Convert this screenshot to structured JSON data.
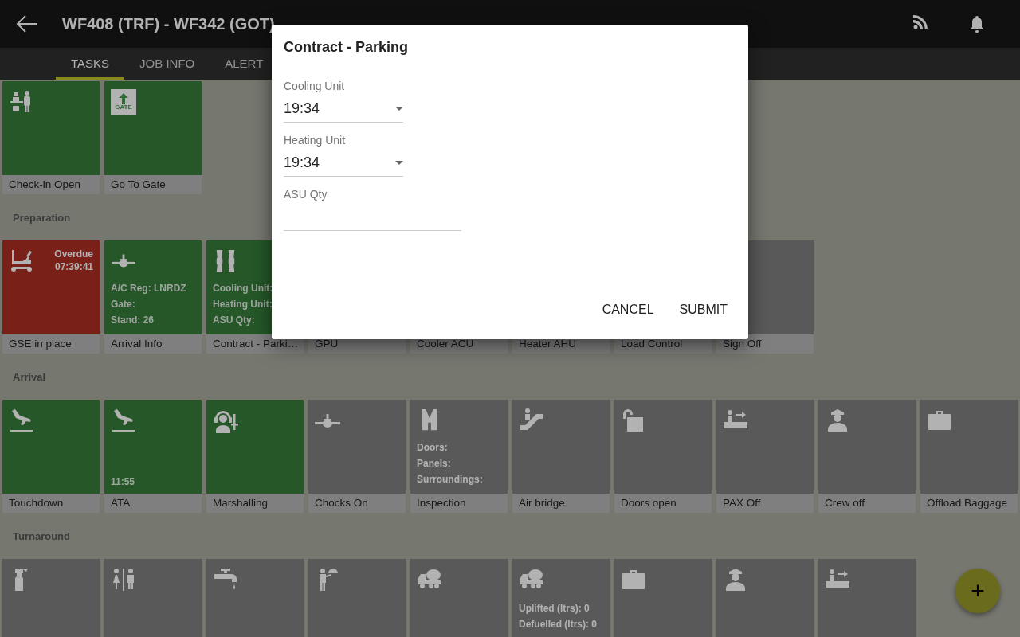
{
  "header": {
    "title": "WF408 (TRF) - WF342 (GOT)"
  },
  "tabs": [
    {
      "label": "TASKS",
      "selected": true
    },
    {
      "label": "JOB INFO",
      "selected": false
    },
    {
      "label": "ALERT",
      "selected": false
    }
  ],
  "sections": [
    {
      "tiles": [
        {
          "label": "Check-in Open",
          "kind": "done"
        },
        {
          "label": "Go To Gate",
          "kind": "done",
          "sign": "GATE"
        }
      ]
    },
    {
      "title": "Preparation",
      "tiles": [
        {
          "label": "GSE in place",
          "kind": "overdue",
          "alert": [
            "Overdue",
            "07:39:41"
          ]
        },
        {
          "label": "Arrival Info",
          "kind": "done",
          "details": [
            "A/C Reg: LNRDZ",
            "Gate:",
            "Stand: 26"
          ]
        },
        {
          "label": "Contract - Parki…",
          "kind": "done",
          "details": [
            "Cooling Unit:",
            "Heating Unit:",
            "ASU Qty:"
          ]
        },
        {
          "label": "GPU"
        },
        {
          "label": "Cooler ACU"
        },
        {
          "label": "Heater AHU"
        },
        {
          "label": "Load Control"
        },
        {
          "label": "Sign Off",
          "kind": "pending"
        }
      ]
    },
    {
      "title": "Arrival",
      "tiles": [
        {
          "label": "Touchdown",
          "kind": "done"
        },
        {
          "label": "ATA",
          "kind": "done",
          "time": "11:55"
        },
        {
          "label": "Marshalling",
          "kind": "done"
        },
        {
          "label": "Chocks On",
          "kind": "pending"
        },
        {
          "label": "Inspection",
          "kind": "pending",
          "details": [
            "Doors:",
            "Panels:",
            "Surroundings:"
          ]
        },
        {
          "label": "Air bridge",
          "kind": "pending"
        },
        {
          "label": "Doors open",
          "kind": "pending"
        },
        {
          "label": "PAX Off",
          "kind": "pending"
        },
        {
          "label": "Crew off",
          "kind": "pending"
        },
        {
          "label": "Offload Baggage",
          "kind": "pending"
        }
      ]
    },
    {
      "title": "Turnaround",
      "tiles": [
        {
          "kind": "pending"
        },
        {
          "kind": "pending"
        },
        {
          "kind": "pending"
        },
        {
          "kind": "pending"
        },
        {
          "kind": "pending"
        },
        {
          "kind": "pending",
          "details": [
            "Uplifted (ltrs): 0",
            "Defuelled (ltrs): 0"
          ]
        },
        {
          "kind": "pending"
        },
        {
          "kind": "pending"
        },
        {
          "kind": "pending"
        }
      ]
    }
  ],
  "fab": {
    "label": "+"
  },
  "dialog": {
    "modal": true,
    "title": "Contract - Parking",
    "fields": [
      {
        "label": "Cooling Unit",
        "kind": "select",
        "value": "19:34"
      },
      {
        "label": "Heating Unit",
        "kind": "select",
        "value": "19:34"
      },
      {
        "label": "ASU Qty",
        "kind": "input"
      }
    ],
    "buttons": [
      "CANCEL",
      "SUBMIT"
    ]
  }
}
